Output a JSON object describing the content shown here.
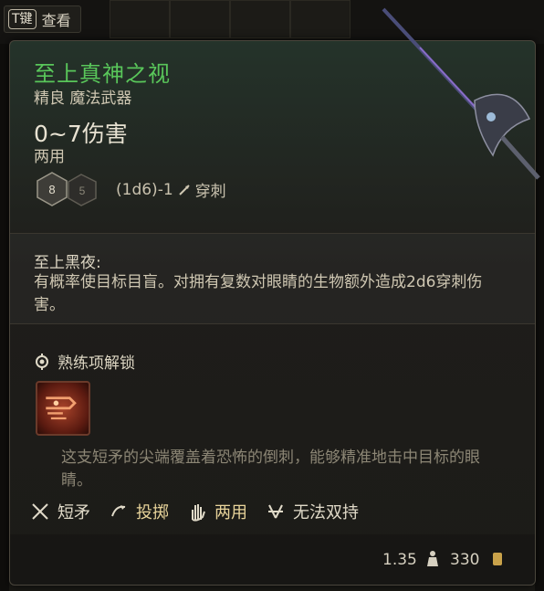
{
  "hotkey": {
    "key": "T键",
    "label": "查看"
  },
  "item": {
    "name": "至上真神之视",
    "rarity_type": "精良 魔法武器",
    "damage": "0~7伤害",
    "handedness": "两用",
    "dice": [
      "8",
      "5"
    ],
    "dice_formula": "(1d6)-1",
    "damage_type": "穿刺"
  },
  "passive": {
    "name": "至上黑夜:",
    "description": "有概率使目标目盲。对拥有复数对眼睛的生物额外造成2d6穿刺伤害。"
  },
  "proficiency": {
    "label": "熟练项解锁"
  },
  "flavor_text": "这支短矛的尖端覆盖着恐怖的倒刺，能够精准地击中目标的眼睛。",
  "properties": [
    {
      "icon": "crossed-spears-icon",
      "label": "短矛",
      "color": "#e0dac8"
    },
    {
      "icon": "throw-icon",
      "label": "投掷",
      "color": "#e8d49a"
    },
    {
      "icon": "hand-icon",
      "label": "两用",
      "color": "#e8d49a"
    },
    {
      "icon": "no-dual-wield-icon",
      "label": "无法双持",
      "color": "#e0dac8"
    }
  ],
  "footer": {
    "weight": "1.35",
    "price": "330"
  },
  "colors": {
    "title": "#59c65a",
    "accent": "#e8d49a"
  }
}
